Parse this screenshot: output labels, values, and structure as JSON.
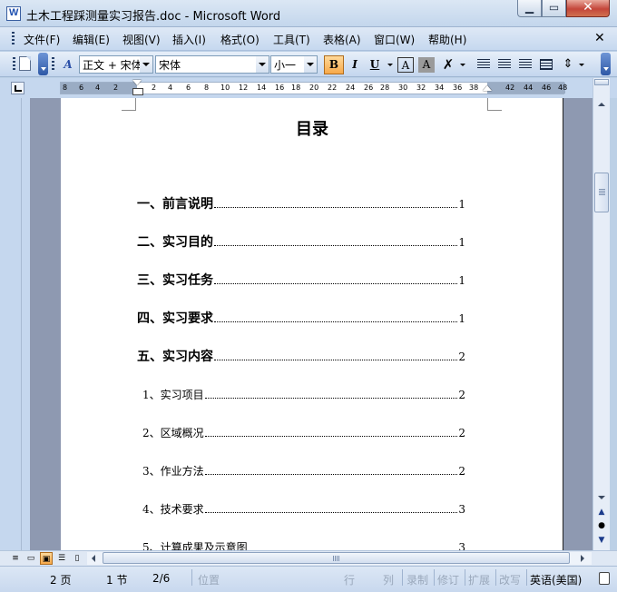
{
  "window": {
    "title": "土木工程踩测量实习报告.doc - Microsoft Word",
    "min_glyph": "▁",
    "max_glyph": "▭",
    "close_glyph": "✕"
  },
  "menu": {
    "items": [
      "文件(F)",
      "编辑(E)",
      "视图(V)",
      "插入(I)",
      "格式(O)",
      "工具(T)",
      "表格(A)",
      "窗口(W)",
      "帮助(H)"
    ],
    "close_doc": "✕"
  },
  "toolbar": {
    "style_value": "正文 + 宋体",
    "font_value": "宋体",
    "size_value": "小一",
    "bold_label": "B",
    "italic_label": "I",
    "underline_label": "U",
    "char_border_label": "A",
    "char_shading_label": "A",
    "styles_icon_label": "A"
  },
  "ruler": {
    "numbers": [
      "8",
      "6",
      "4",
      "2",
      "2",
      "4",
      "6",
      "8",
      "10",
      "12",
      "14",
      "16",
      "18",
      "20",
      "22",
      "24",
      "26",
      "28",
      "30",
      "32",
      "34",
      "36",
      "38",
      "42",
      "44",
      "46",
      "48"
    ]
  },
  "document": {
    "title": "目录",
    "toc": [
      {
        "text": "一、前言说明",
        "page": "1",
        "level": "major"
      },
      {
        "text": "二、实习目的",
        "page": "1",
        "level": "major"
      },
      {
        "text": "三、实习任务",
        "page": "1",
        "level": "major"
      },
      {
        "text": "四、实习要求",
        "page": "1",
        "level": "major"
      },
      {
        "text": "五、实习内容",
        "page": "2",
        "level": "major"
      },
      {
        "text": "1、实习项目",
        "page": "2",
        "level": "minor"
      },
      {
        "text": "2、区域概况",
        "page": "2",
        "level": "minor"
      },
      {
        "text": "3、作业方法",
        "page": "2",
        "level": "minor"
      },
      {
        "text": "4、技术要求",
        "page": "3",
        "level": "minor"
      },
      {
        "text": "5、计算成果及示意图",
        "page": "3",
        "level": "minor"
      }
    ]
  },
  "status": {
    "page": "2 页",
    "section": "1 节",
    "page_of": "2/6",
    "position": "位置",
    "line": "行",
    "column": "列",
    "record": "录制",
    "revise": "修订",
    "extend": "扩展",
    "overwrite": "改写",
    "language": "英语(美国)"
  },
  "scroll": {
    "prev_page": "▲",
    "browse": "●",
    "next_page": "▼"
  }
}
